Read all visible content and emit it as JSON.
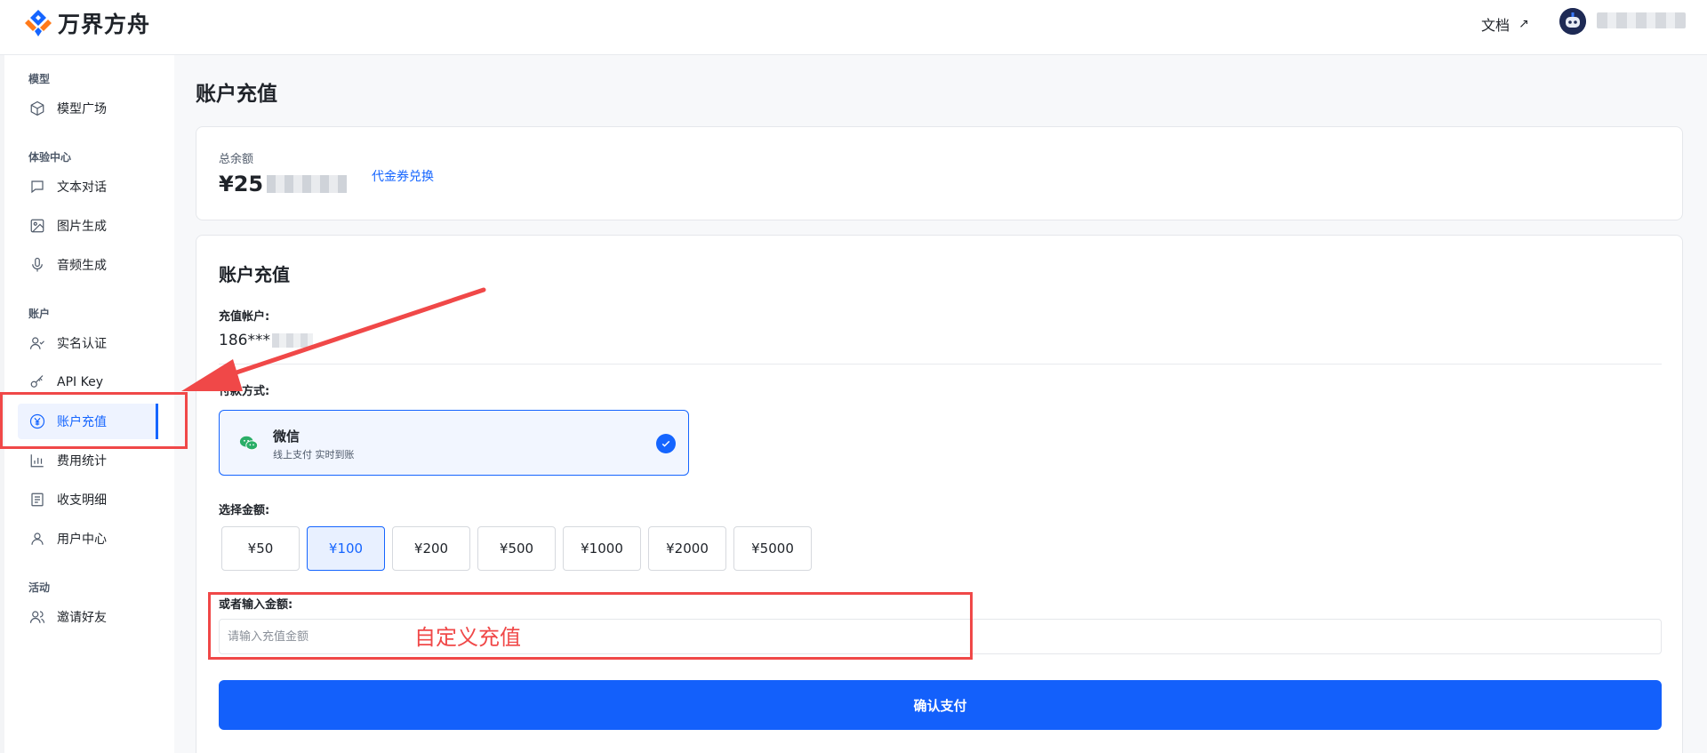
{
  "header": {
    "brand": "万界方舟",
    "docs_label": "文档",
    "docs_arrow": "↗"
  },
  "sidebar": {
    "sections": [
      {
        "label": "模型",
        "items": [
          {
            "label": "模型广场",
            "icon": "cube-icon"
          }
        ]
      },
      {
        "label": "体验中心",
        "items": [
          {
            "label": "文本对话",
            "icon": "chat-icon"
          },
          {
            "label": "图片生成",
            "icon": "image-icon"
          },
          {
            "label": "音频生成",
            "icon": "mic-icon"
          }
        ]
      },
      {
        "label": "账户",
        "items": [
          {
            "label": "实名认证",
            "icon": "user-check-icon"
          },
          {
            "label": "API Key",
            "icon": "key-icon"
          },
          {
            "label": "账户充值",
            "icon": "yuan-icon",
            "active": true
          },
          {
            "label": "费用统计",
            "icon": "bar-chart-icon"
          },
          {
            "label": "收支明细",
            "icon": "document-icon"
          },
          {
            "label": "用户中心",
            "icon": "user-icon"
          }
        ]
      },
      {
        "label": "活动",
        "items": [
          {
            "label": "邀请好友",
            "icon": "users-icon"
          }
        ]
      }
    ]
  },
  "main": {
    "page_title": "账户充值",
    "balance": {
      "label": "总余额",
      "currency": "¥",
      "visible_digits": "25",
      "voucher_link": "代金券兑换"
    },
    "recharge": {
      "title": "账户充值",
      "account_label": "充值帐户:",
      "account_value": "186***",
      "payment_label": "付款方式:",
      "payment_option": {
        "name": "微信",
        "desc": "线上支付 实时到账"
      },
      "amount_label": "选择金额:",
      "amounts": [
        "¥50",
        "¥100",
        "¥200",
        "¥500",
        "¥1000",
        "¥2000",
        "¥5000"
      ],
      "selected_amount": "¥100",
      "custom_label": "或者输入金额:",
      "custom_placeholder": "请输入充值金额",
      "confirm_label": "确认支付"
    }
  },
  "annotations": {
    "custom_text": "自定义充值",
    "color": "#f04848"
  }
}
